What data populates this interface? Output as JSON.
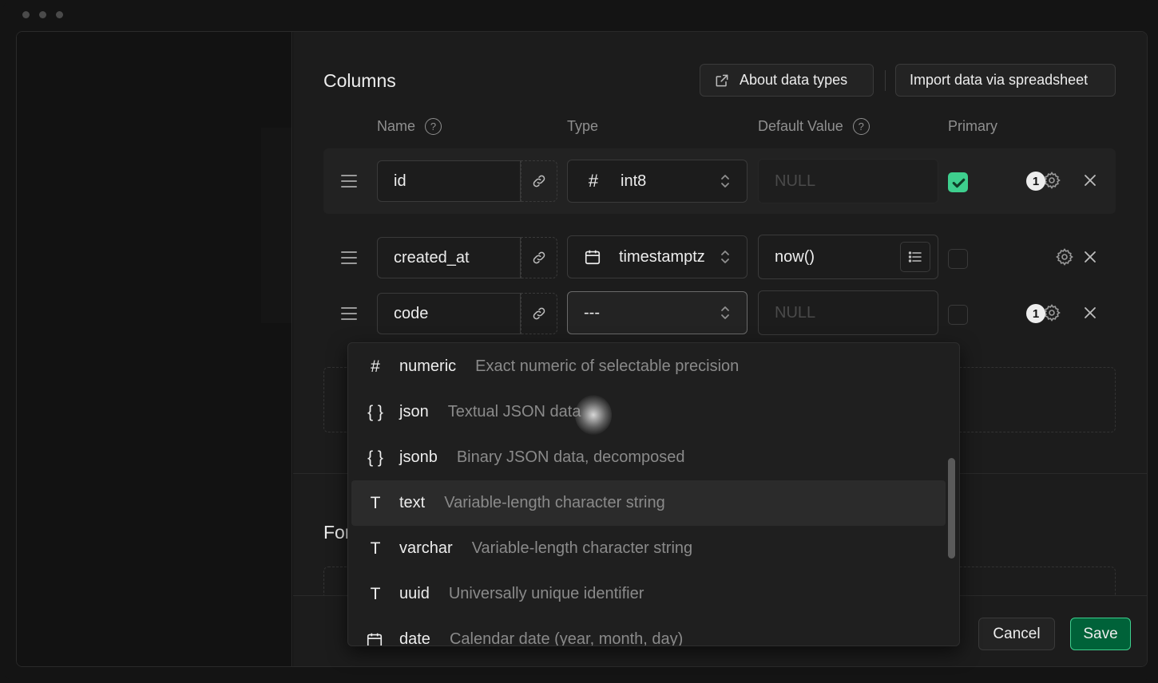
{
  "columns": {
    "title": "Columns",
    "about_button": "About data types",
    "import_button": "Import data via spreadsheet",
    "headers": {
      "name": "Name",
      "type": "Type",
      "default_value": "Default Value",
      "primary": "Primary"
    },
    "rows": [
      {
        "name": "id",
        "type": "int8",
        "type_icon": "hash-icon",
        "default": "NULL",
        "default_is_placeholder": true,
        "primary": true,
        "badge": "1"
      },
      {
        "name": "created_at",
        "type": "timestamptz",
        "type_icon": "calendar-icon",
        "default": "now()",
        "default_is_placeholder": false,
        "primary": false,
        "badge": ""
      },
      {
        "name": "code",
        "type": "---",
        "type_icon": "",
        "default": "NULL",
        "default_is_placeholder": true,
        "primary": false,
        "badge": "1"
      }
    ]
  },
  "foreign_keys": {
    "title_partial": "For"
  },
  "footer": {
    "cancel": "Cancel",
    "save": "Save"
  },
  "type_dropdown": {
    "options": [
      {
        "icon": "#",
        "icon_name": "hash-icon",
        "name": "numeric",
        "desc": "Exact numeric of selectable precision"
      },
      {
        "icon": "{ }",
        "icon_name": "braces-icon",
        "name": "json",
        "desc": "Textual JSON data"
      },
      {
        "icon": "{ }",
        "icon_name": "braces-icon",
        "name": "jsonb",
        "desc": "Binary JSON data, decomposed"
      },
      {
        "icon": "T",
        "icon_name": "text-icon",
        "name": "text",
        "desc": "Variable-length character string",
        "highlighted": true
      },
      {
        "icon": "T",
        "icon_name": "text-icon",
        "name": "varchar",
        "desc": "Variable-length character string"
      },
      {
        "icon": "T",
        "icon_name": "text-icon",
        "name": "uuid",
        "desc": "Universally unique identifier"
      },
      {
        "icon": "cal",
        "icon_name": "calendar-icon",
        "name": "date",
        "desc": "Calendar date (year, month, day)"
      }
    ]
  },
  "colors": {
    "accent_green": "#3ecf8e",
    "save_bg": "#006239",
    "background": "#1c1c1c"
  }
}
